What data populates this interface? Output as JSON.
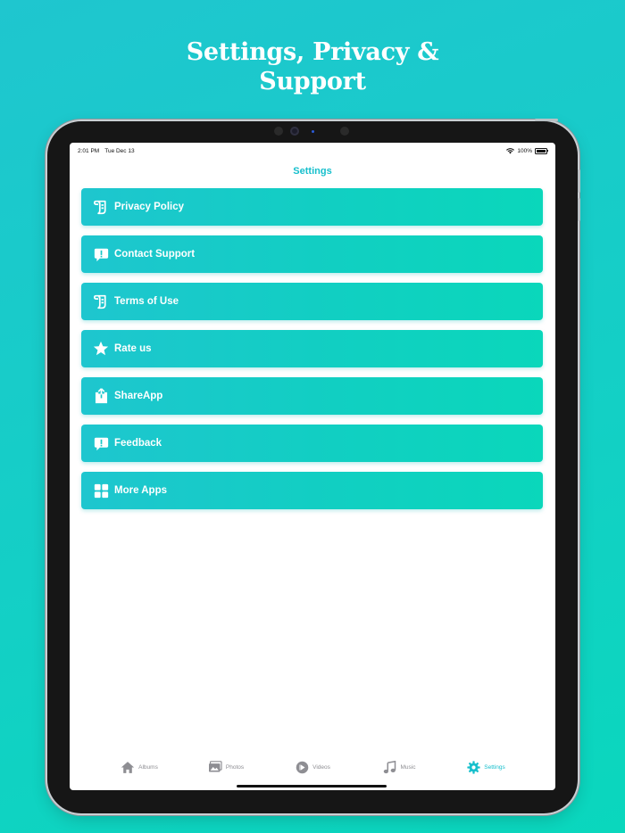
{
  "headline": {
    "line1": "Settings, Privacy &",
    "line2": "Support"
  },
  "status": {
    "time": "2:01 PM",
    "date": "Tue Dec 13",
    "battery": "100%"
  },
  "nav": {
    "title": "Settings"
  },
  "menu": [
    {
      "label": "Privacy Policy",
      "icon": "scroll-icon"
    },
    {
      "label": "Contact Support",
      "icon": "exclamation-bubble-icon"
    },
    {
      "label": "Terms of Use",
      "icon": "scroll-icon"
    },
    {
      "label": "Rate us",
      "icon": "star-icon"
    },
    {
      "label": "ShareApp",
      "icon": "share-icon"
    },
    {
      "label": "Feedback",
      "icon": "exclamation-bubble-icon"
    },
    {
      "label": "More Apps",
      "icon": "grid-icon"
    }
  ],
  "tabs": [
    {
      "label": "Albums",
      "icon": "house-icon"
    },
    {
      "label": "Photos",
      "icon": "photos-icon"
    },
    {
      "label": "Videos",
      "icon": "play-circle-icon"
    },
    {
      "label": "Music",
      "icon": "music-note-icon"
    },
    {
      "label": "Settings",
      "icon": "gear-icon",
      "active": true
    }
  ],
  "colors": {
    "accent": "#16bfcc",
    "background": "#14cfc6",
    "inactive_tab": "#8e8e93"
  }
}
